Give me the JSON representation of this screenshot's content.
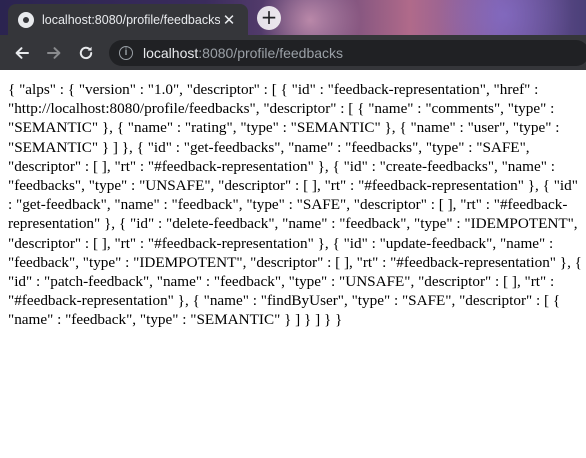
{
  "browser": {
    "tab": {
      "title": "localhost:8080/profile/feedbacks"
    },
    "new_tab_symbol": "+",
    "close_symbol": "✕",
    "url": {
      "host": "localhost",
      "rest": ":8080/profile/feedbacks"
    }
  },
  "page": {
    "body_text": "{ \"alps\" : { \"version\" : \"1.0\", \"descriptor\" : [ { \"id\" : \"feedback-representation\", \"href\" : \"http://localhost:8080/profile/feedbacks\", \"descriptor\" : [ { \"name\" : \"comments\", \"type\" : \"SEMANTIC\" }, { \"name\" : \"rating\", \"type\" : \"SEMANTIC\" }, { \"name\" : \"user\", \"type\" : \"SEMANTIC\" } ] }, { \"id\" : \"get-feedbacks\", \"name\" : \"feedbacks\", \"type\" : \"SAFE\", \"descriptor\" : [ ], \"rt\" : \"#feedback-representation\" }, { \"id\" : \"create-feedbacks\", \"name\" : \"feedbacks\", \"type\" : \"UNSAFE\", \"descriptor\" : [ ], \"rt\" : \"#feedback-representation\" }, { \"id\" : \"get-feedback\", \"name\" : \"feedback\", \"type\" : \"SAFE\", \"descriptor\" : [ ], \"rt\" : \"#feedback-representation\" }, { \"id\" : \"delete-feedback\", \"name\" : \"feedback\", \"type\" : \"IDEMPOTENT\", \"descriptor\" : [ ], \"rt\" : \"#feedback-representation\" }, { \"id\" : \"update-feedback\", \"name\" : \"feedback\", \"type\" : \"IDEMPOTENT\", \"descriptor\" : [ ], \"rt\" : \"#feedback-representation\" }, { \"id\" : \"patch-feedback\", \"name\" : \"feedback\", \"type\" : \"UNSAFE\", \"descriptor\" : [ ], \"rt\" : \"#feedback-representation\" }, { \"name\" : \"findByUser\", \"type\" : \"SAFE\", \"descriptor\" : [ { \"name\" : \"feedback\", \"type\" : \"SEMANTIC\" } ] } ] } }"
  },
  "icons": {
    "back": "arrow-left-icon",
    "forward": "arrow-right-icon",
    "reload": "reload-icon",
    "site_info": "info-icon",
    "favicon": "globe-icon"
  },
  "colors": {
    "chrome_dark": "#35363a",
    "omnibox_bg": "#202124",
    "chrome_text": "#e8eaed",
    "muted_text": "#9aa0a6"
  }
}
